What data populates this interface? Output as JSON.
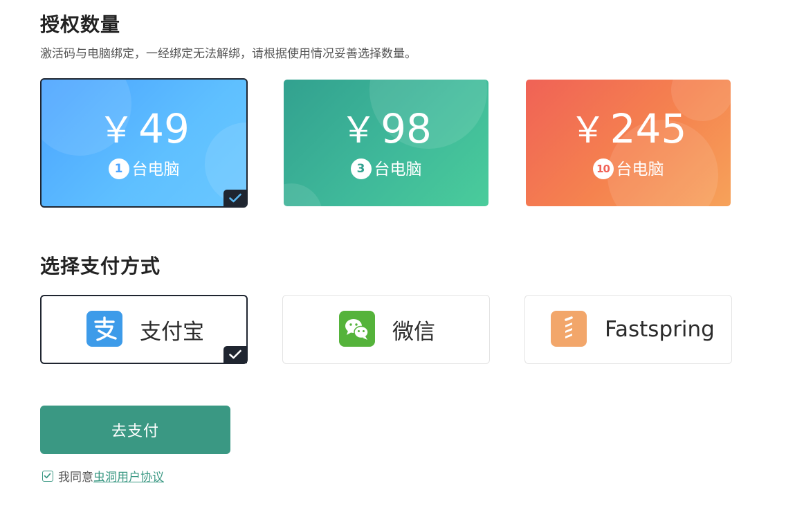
{
  "license": {
    "title": "授权数量",
    "subtitle": "激活码与电脑绑定，一经绑定无法解绑，请根据使用情况妥善选择数量。",
    "plans": [
      {
        "currency": "￥",
        "price": "49",
        "count": "1",
        "unit": "台电脑",
        "selected": true,
        "color": "#4aa3ff"
      },
      {
        "currency": "￥",
        "price": "98",
        "count": "3",
        "unit": "台电脑",
        "selected": false,
        "color": "#32a18f"
      },
      {
        "currency": "￥",
        "price": "245",
        "count": "10",
        "unit": "台电脑",
        "selected": false,
        "color": "#f06256"
      }
    ]
  },
  "payment": {
    "title": "选择支付方式",
    "methods": [
      {
        "label": "支付宝",
        "icon": "alipay-icon",
        "selected": true,
        "color": "#3d9be9"
      },
      {
        "label": "微信",
        "icon": "wechat-icon",
        "selected": false,
        "color": "#55b33b"
      },
      {
        "label": "Fastspring",
        "icon": "fastspring-icon",
        "selected": false,
        "color": "#f2a66a"
      }
    ]
  },
  "actions": {
    "pay_label": "去支付",
    "pay_color": "#3a9883"
  },
  "agreement": {
    "checked": true,
    "prefix": "我同意",
    "link": "虫洞用户协议"
  }
}
